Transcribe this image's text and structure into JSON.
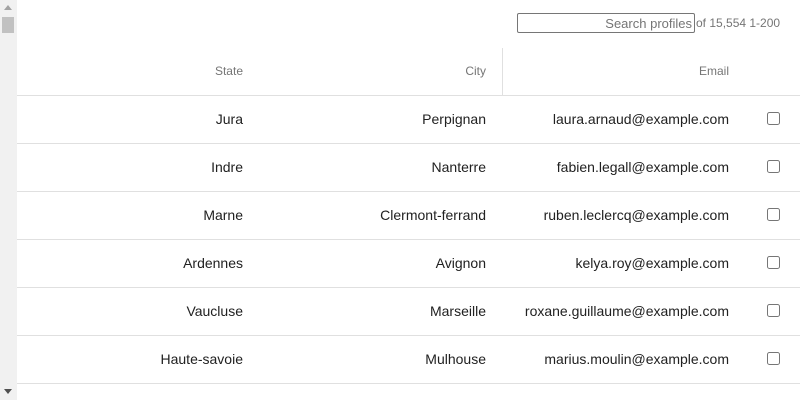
{
  "toolbar": {
    "search_placeholder": "Search profiles",
    "search_value": "",
    "pager": "of 15,554 1-200"
  },
  "columns": {
    "state": "State",
    "city": "City",
    "email": "Email"
  },
  "rows": [
    {
      "state": "Jura",
      "city": "Perpignan",
      "email": "laura.arnaud@example.com",
      "selected": false
    },
    {
      "state": "Indre",
      "city": "Nanterre",
      "email": "fabien.legall@example.com",
      "selected": false
    },
    {
      "state": "Marne",
      "city": "Clermont-ferrand",
      "email": "ruben.leclercq@example.com",
      "selected": false
    },
    {
      "state": "Ardennes",
      "city": "Avignon",
      "email": "kelya.roy@example.com",
      "selected": false
    },
    {
      "state": "Vaucluse",
      "city": "Marseille",
      "email": "roxane.guillaume@example.com",
      "selected": false
    },
    {
      "state": "Haute-savoie",
      "city": "Mulhouse",
      "email": "marius.moulin@example.com",
      "selected": false
    }
  ],
  "colors": {
    "header_text": "#757575",
    "cell_text": "#212121",
    "divider": "#e0e0e0"
  }
}
